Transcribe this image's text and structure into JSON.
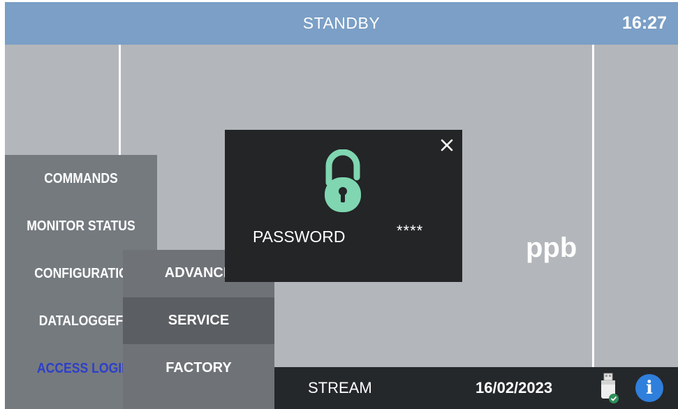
{
  "header": {
    "title": "STANDBY",
    "clock": "16:27"
  },
  "display": {
    "unit": "ppb"
  },
  "main_menu": {
    "items": [
      {
        "label": "COMMANDS"
      },
      {
        "label": "MONITOR STATUS"
      },
      {
        "label": "CONFIGURATIC"
      },
      {
        "label": "DATALOGGEF"
      },
      {
        "label": "ACCESS LOGII",
        "active": true
      }
    ],
    "active_color": "#2d3fc9"
  },
  "sub_menu": {
    "items": [
      {
        "label": "ADVANCE"
      },
      {
        "label": "SERVICE",
        "selected": true
      },
      {
        "label": "FACTORY"
      }
    ]
  },
  "bottom_bar": {
    "stream": "STREAM",
    "date": "16/02/2023",
    "usb_icon": "usb-drive-ok-icon",
    "info_icon": "info-icon",
    "info_glyph": "i"
  },
  "dialog": {
    "lock_icon": "unlocked-padlock-icon",
    "lock_color": "#7fd6b0",
    "password_label": "PASSWORD",
    "password_value": "****",
    "close_glyph": "×"
  }
}
